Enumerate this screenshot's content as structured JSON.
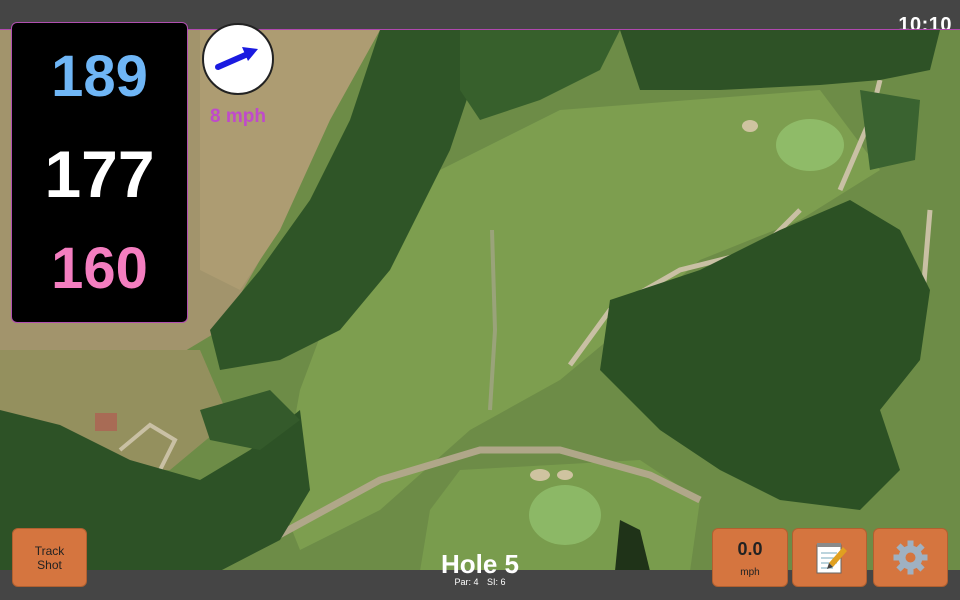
{
  "status_bar": {
    "time": "10:10"
  },
  "distances": {
    "back": "189",
    "middle": "177",
    "front": "160"
  },
  "wind": {
    "speed_label": "8 mph",
    "direction_icon": "arrow-icon"
  },
  "buttons": {
    "track_shot_line1": "Track",
    "track_shot_line2": "Shot",
    "speed_value": "0.0",
    "speed_unit": "mph",
    "notes_icon": "notepad-icon",
    "settings_icon": "gear-icon"
  },
  "hole": {
    "title": "Hole 5",
    "par": "Par: 4",
    "si": "SI: 6"
  },
  "colors": {
    "back": "#6fb6f6",
    "middle": "#ffffff",
    "front": "#f47ec0",
    "accent": "#c04acb",
    "button": "#d5753f"
  }
}
